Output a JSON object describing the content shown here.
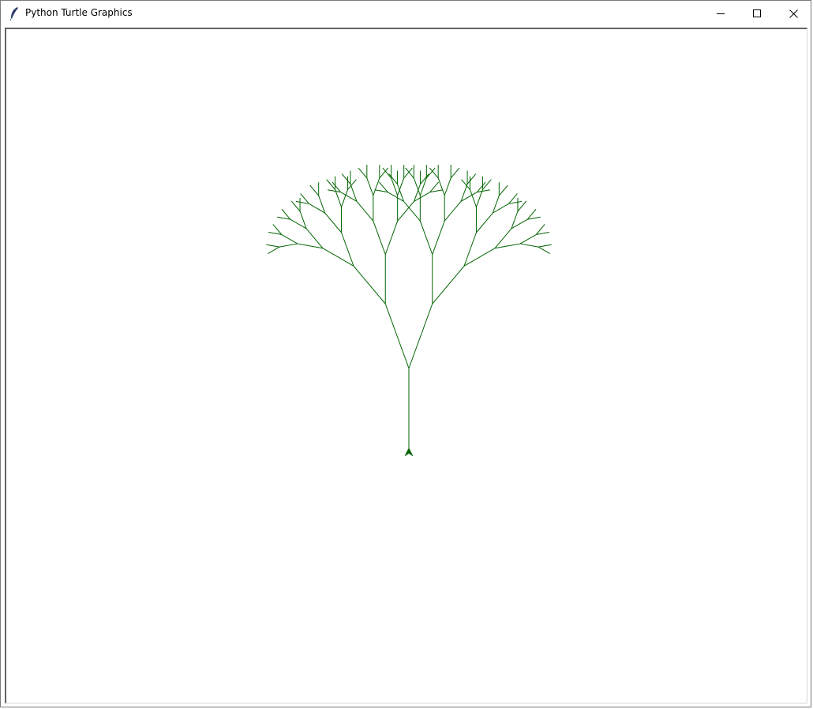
{
  "window": {
    "title": "Python Turtle Graphics",
    "icon": "feather-icon",
    "controls": {
      "minimize_icon": "minimize-icon",
      "maximize_icon": "maximize-icon",
      "close_icon": "close-icon"
    }
  },
  "canvas": {
    "background": "#ffffff",
    "pen_color": "#006400",
    "turtle_color": "#006400",
    "drawing": "fractal-tree",
    "tree": {
      "depth": 6,
      "trunk_length": 106,
      "branch_ratio": 0.72,
      "branch_angle_deg": 20,
      "extra_fork_angle_deg": 20
    }
  }
}
